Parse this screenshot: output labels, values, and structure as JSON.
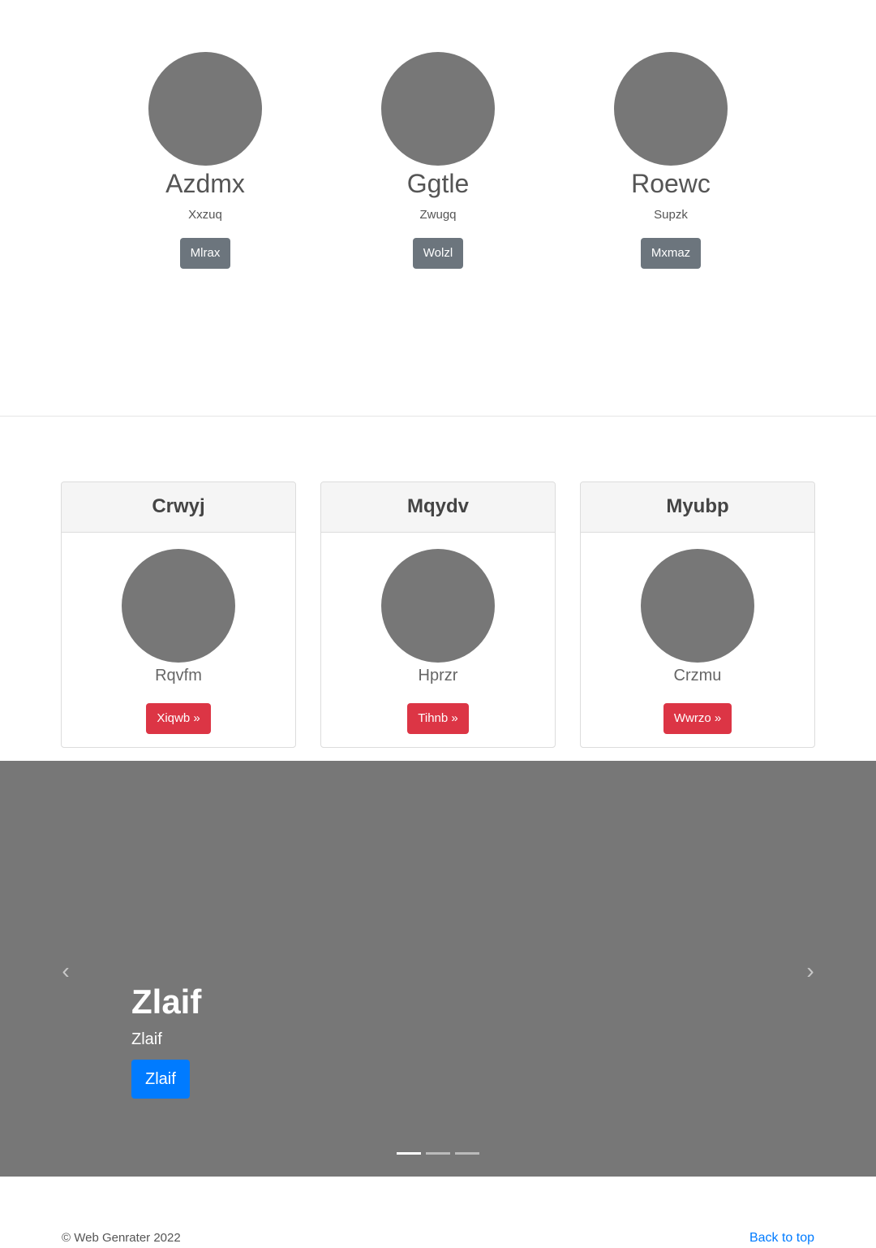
{
  "profiles": [
    {
      "name": "Azdmx",
      "subtitle": "Xxzuq",
      "button": "Mlrax"
    },
    {
      "name": "Ggtle",
      "subtitle": "Zwugq",
      "button": "Wolzl"
    },
    {
      "name": "Roewc",
      "subtitle": "Supzk",
      "button": "Mxmaz"
    }
  ],
  "cards": [
    {
      "title": "Crwyj",
      "name": "Rqvfm",
      "button": "Xiqwb »"
    },
    {
      "title": "Mqydv",
      "name": "Hprzr",
      "button": "Tihnb »"
    },
    {
      "title": "Myubp",
      "name": "Crzmu",
      "button": "Wwrzo »"
    }
  ],
  "carousel": {
    "heading": "Zlaif",
    "text": "Zlaif",
    "button": "Zlaif",
    "prev_icon": "‹",
    "next_icon": "›",
    "indicator_count": 3,
    "active_index": 0
  },
  "footer": {
    "copyright": "© Web Genrater 2022",
    "back_to_top": "Back to top"
  },
  "colors": {
    "placeholder": "#777777",
    "secondary": "#6c757d",
    "danger": "#dc3545",
    "primary": "#007bff"
  }
}
